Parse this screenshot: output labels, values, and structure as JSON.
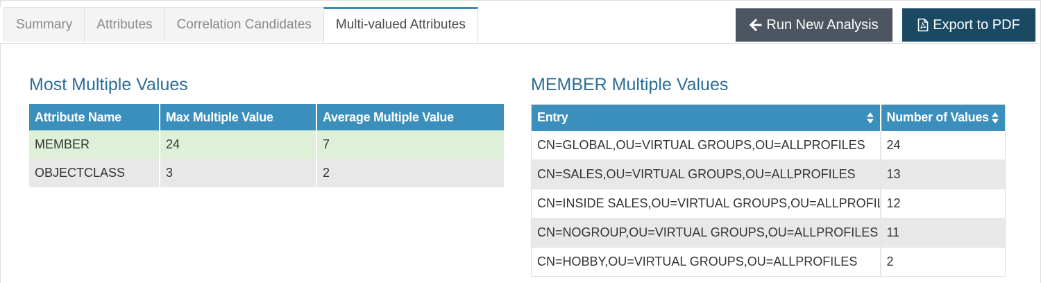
{
  "tabs": [
    {
      "label": "Summary",
      "active": false
    },
    {
      "label": "Attributes",
      "active": false
    },
    {
      "label": "Correlation Candidates",
      "active": false
    },
    {
      "label": "Multi-valued Attributes",
      "active": true
    }
  ],
  "toolbar": {
    "run_label": "Run New Analysis",
    "run_icon": "arrow-left-icon",
    "export_label": "Export to PDF",
    "export_icon": "pdf-file-icon"
  },
  "left": {
    "title": "Most Multiple Values",
    "columns": [
      "Attribute Name",
      "Max Multiple Value",
      "Average Multiple Value"
    ],
    "rows": [
      [
        "MEMBER",
        "24",
        "7"
      ],
      [
        "OBJECTCLASS",
        "3",
        "2"
      ]
    ]
  },
  "right": {
    "title": "MEMBER Multiple Values",
    "columns": [
      "Entry",
      "Number of Values"
    ],
    "sort_icon": "sort-icon",
    "rows": [
      [
        "CN=GLOBAL,OU=VIRTUAL GROUPS,OU=ALLPROFILES",
        "24"
      ],
      [
        "CN=SALES,OU=VIRTUAL GROUPS,OU=ALLPROFILES",
        "13"
      ],
      [
        "CN=INSIDE SALES,OU=VIRTUAL GROUPS,OU=ALLPROFILES",
        "12"
      ],
      [
        "CN=NOGROUP,OU=VIRTUAL GROUPS,OU=ALLPROFILES",
        "11"
      ],
      [
        "CN=HOBBY,OU=VIRTUAL GROUPS,OU=ALLPROFILES",
        "2"
      ]
    ]
  },
  "colors": {
    "accent": "#3b8fbc",
    "title": "#2d6e95",
    "run_button": "#4d5561",
    "export_button": "#1a4a63",
    "highlight_row": "#dff0d8"
  }
}
